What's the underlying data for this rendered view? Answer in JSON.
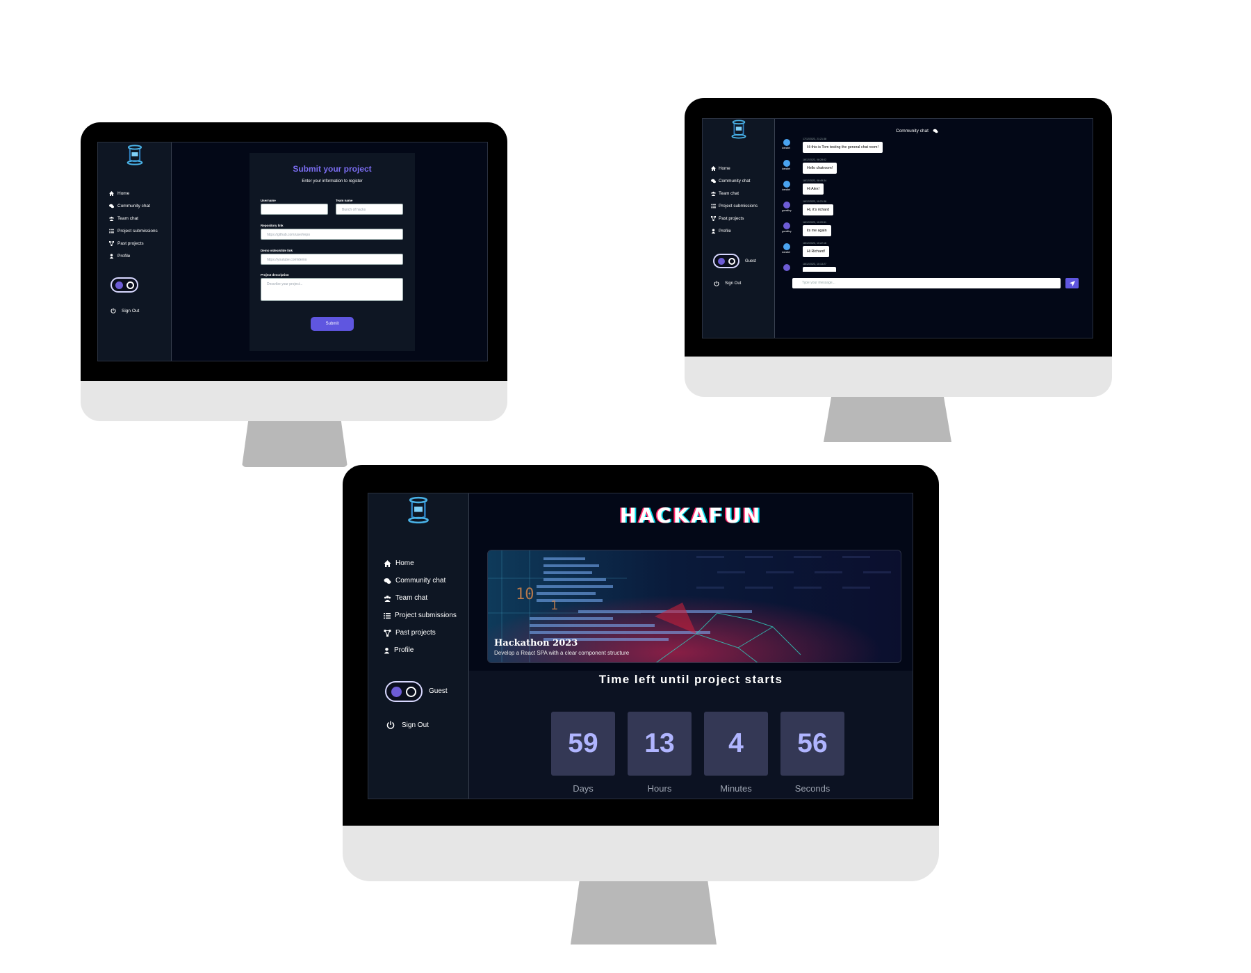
{
  "nav_items": [
    {
      "label": "Home",
      "icon": "home-icon"
    },
    {
      "label": "Community chat",
      "icon": "chat-icon"
    },
    {
      "label": "Team chat",
      "icon": "users-icon"
    },
    {
      "label": "Project submissions",
      "icon": "list-icon"
    },
    {
      "label": "Past projects",
      "icon": "share-nodes-icon"
    },
    {
      "label": "Profile",
      "icon": "user-icon"
    }
  ],
  "sign_out": "Sign Out",
  "guest_label": "Guest",
  "colors": {
    "accent": "#5f56e0",
    "title_accent": "#7a6cf0",
    "background": "#030817",
    "sidebar": "#0e1623"
  },
  "submit_page": {
    "title": "Submit your project",
    "subtitle": "Enter your information to register",
    "username_label": "Username",
    "username_value": "",
    "teamname_label": "Team name",
    "teamname_placeholder": "Bunch of hacks",
    "repo_label": "Repository link",
    "repo_placeholder": "https://github.com/user/repo",
    "demo_label": "Demo video/slide link",
    "demo_placeholder": "https://youtube.com/demo",
    "description_label": "Project description",
    "description_placeholder": "Describe your project...",
    "submit_label": "Submit"
  },
  "chat_page": {
    "title": "Community chat",
    "input_placeholder": "Type your message...",
    "messages": [
      {
        "user": "ivandiel",
        "time": "17/12/2023, 21:21:38",
        "text": "Hi this is Tom testing the general chat room!",
        "avatar_color": "#4aa3f0"
      },
      {
        "user": "ivandiel",
        "time": "18/12/2023, 08:28:02",
        "text": "Hello chatroom!",
        "avatar_color": "#4aa3f0"
      },
      {
        "user": "ivandiel",
        "time": "18/12/2023, 08:49:34",
        "text": "Hi Alex!",
        "avatar_color": "#4aa3f0"
      },
      {
        "user": "guestlizy",
        "time": "18/12/2023, 10:21:38",
        "text": "Hi, it's richard",
        "avatar_color": "#6d5cd6"
      },
      {
        "user": "guestlizy",
        "time": "18/12/2023, 10:20:51",
        "text": "its me again",
        "avatar_color": "#6d5cd6"
      },
      {
        "user": "ivandiel",
        "time": "18/12/2023, 10:22:16",
        "text": "Hi Richard!",
        "avatar_color": "#4aa3f0"
      },
      {
        "user": "guestlizy",
        "time": "18/12/2023, 10:13:27",
        "text": "",
        "avatar_color": "#6d5cd6"
      }
    ]
  },
  "dashboard": {
    "brand": "HACKAFUN",
    "hero_title": "Hackathon 2023",
    "hero_subtitle": "Develop a React SPA with a clear component structure",
    "countdown_title": "Time left until project starts",
    "countdown": [
      {
        "value": "59",
        "label": "Days"
      },
      {
        "value": "13",
        "label": "Hours"
      },
      {
        "value": "4",
        "label": "Minutes"
      },
      {
        "value": "56",
        "label": "Seconds"
      }
    ]
  }
}
